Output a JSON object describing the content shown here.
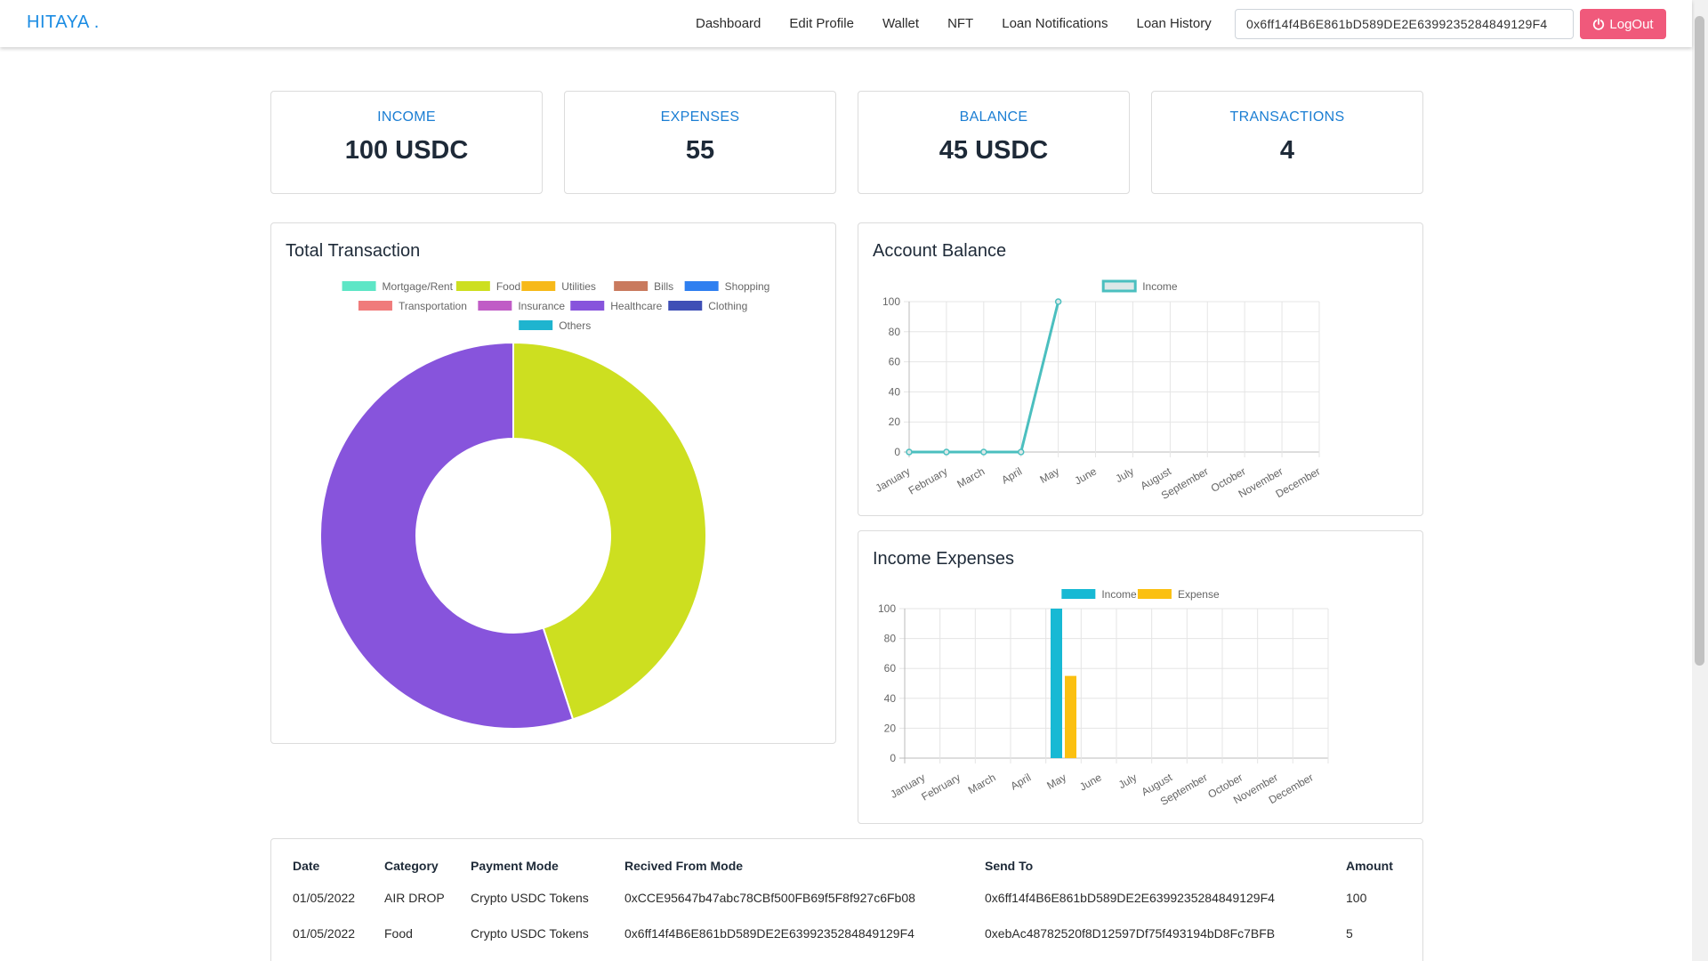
{
  "navbar": {
    "brand": "HITAYA .",
    "links": [
      "Dashboard",
      "Edit Profile",
      "Wallet",
      "NFT",
      "Loan Notifications",
      "Loan History"
    ],
    "wallet_address": "0x6ff14f4B6E861bD589DE2E6399235284849129F4",
    "logout_label": "LogOut"
  },
  "stats": [
    {
      "label": "INCOME",
      "value": "100 USDC"
    },
    {
      "label": "EXPENSES",
      "value": "55"
    },
    {
      "label": "BALANCE",
      "value": "45 USDC"
    },
    {
      "label": "TRANSACTIONS",
      "value": "4"
    }
  ],
  "panels": {
    "total_transaction": "Total Transaction",
    "account_balance": "Account Balance",
    "income_expenses": "Income Expenses"
  },
  "chart_data": [
    {
      "type": "doughnut",
      "title": "Total Transaction",
      "legend_position": "top",
      "categories": [
        "Mortgage/Rent",
        "Food",
        "Utilities",
        "Bills",
        "Shopping",
        "Transportation",
        "Insurance",
        "Healthcare",
        "Clothing",
        "Others"
      ],
      "colors": [
        "#5ee6c6",
        "#cddf20",
        "#f7b91a",
        "#c97a5e",
        "#2f7ff0",
        "#f07b7b",
        "#c05cc6",
        "#8754dc",
        "#3f4fb6",
        "#1eb4cf"
      ],
      "values": [
        0,
        45,
        0,
        0,
        0,
        0,
        0,
        55,
        0,
        0
      ]
    },
    {
      "type": "line",
      "title": "Account Balance",
      "legend_position": "top",
      "x": [
        "January",
        "February",
        "March",
        "April",
        "May",
        "June",
        "July",
        "August",
        "September",
        "October",
        "November",
        "December"
      ],
      "series": [
        {
          "name": "Income",
          "color": "#4bbfbf",
          "values": [
            0,
            0,
            0,
            0,
            100,
            null,
            null,
            null,
            null,
            null,
            null,
            null
          ]
        }
      ],
      "ylim": [
        0,
        100
      ],
      "yticks": [
        0,
        20,
        40,
        60,
        80,
        100
      ],
      "grid": true
    },
    {
      "type": "bar",
      "title": "Income Expenses",
      "legend_position": "top",
      "categories": [
        "January",
        "February",
        "March",
        "April",
        "May",
        "June",
        "July",
        "August",
        "September",
        "October",
        "November",
        "December"
      ],
      "series": [
        {
          "name": "Income",
          "color": "#17b9d4",
          "values": [
            0,
            0,
            0,
            0,
            100,
            0,
            0,
            0,
            0,
            0,
            0,
            0
          ]
        },
        {
          "name": "Expense",
          "color": "#fbc011",
          "values": [
            0,
            0,
            0,
            0,
            55,
            0,
            0,
            0,
            0,
            0,
            0,
            0
          ]
        }
      ],
      "ylim": [
        0,
        100
      ],
      "yticks": [
        0,
        20,
        40,
        60,
        80,
        100
      ],
      "grid": true
    }
  ],
  "table": {
    "headers": [
      "Date",
      "Category",
      "Payment Mode",
      "Recived From Mode",
      "Send To",
      "Amount"
    ],
    "rows": [
      [
        "01/05/2022",
        "AIR DROP",
        "Crypto USDC Tokens",
        "0xCCE95647b47abc78CBf500FB69f5F8f927c6Fb08",
        "0x6ff14f4B6E861bD589DE2E6399235284849129F4",
        "100"
      ],
      [
        "01/05/2022",
        "Food",
        "Crypto USDC Tokens",
        "0x6ff14f4B6E861bD589DE2E6399235284849129F4",
        "0xebAc48782520f8D12597Df75f493194bD8Fc7BFB",
        "5"
      ]
    ]
  }
}
